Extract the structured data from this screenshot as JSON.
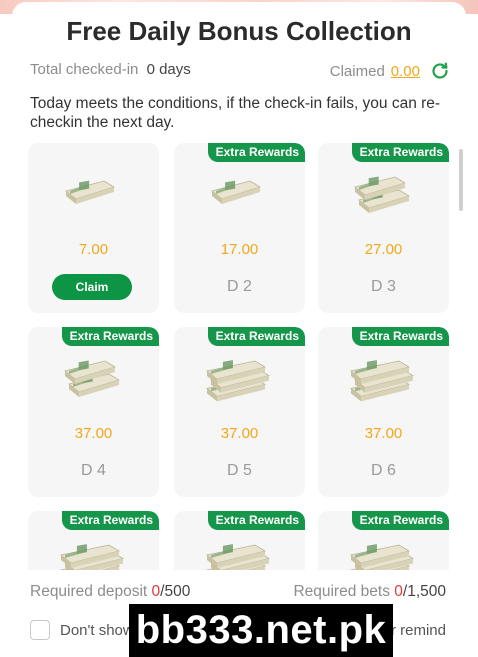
{
  "dialog": {
    "title": "Free Daily Bonus Collection",
    "total_label": "Total checked-in",
    "total_value": "0 days",
    "claimed_label": "Claimed",
    "claimed_value": "0.00",
    "notice": "Today meets the conditions, if the check-in fails, you can re-checkin the next day."
  },
  "cards": [
    {
      "amount": "7.00",
      "day": "",
      "badge": "",
      "button": "Claim",
      "stack": "small"
    },
    {
      "amount": "17.00",
      "day": "D 2",
      "badge": "Extra Rewards",
      "button": "",
      "stack": "small"
    },
    {
      "amount": "27.00",
      "day": "D 3",
      "badge": "Extra Rewards",
      "button": "",
      "stack": "medium"
    },
    {
      "amount": "37.00",
      "day": "D 4",
      "badge": "Extra Rewards",
      "button": "",
      "stack": "medium"
    },
    {
      "amount": "37.00",
      "day": "D 5",
      "badge": "Extra Rewards",
      "button": "",
      "stack": "large"
    },
    {
      "amount": "37.00",
      "day": "D 6",
      "badge": "Extra Rewards",
      "button": "",
      "stack": "large"
    },
    {
      "amount": "",
      "day": "",
      "badge": "Extra Rewards",
      "button": "",
      "stack": "xlarge"
    },
    {
      "amount": "",
      "day": "",
      "badge": "Extra Rewards",
      "button": "",
      "stack": "xlarge"
    },
    {
      "amount": "",
      "day": "",
      "badge": "Extra Rewards",
      "button": "",
      "stack": "xlarge"
    }
  ],
  "requirements": {
    "deposit_label": "Required deposit",
    "deposit_current": "0",
    "deposit_target": "/500",
    "bets_label": "Required bets",
    "bets_current": "0",
    "bets_target": "/1,500"
  },
  "remind": {
    "dont_show": "Don't show",
    "tail": "r remind"
  },
  "watermark": "bb333.net.pk",
  "colors": {
    "accent_green": "#16964a",
    "amount_orange": "#f0a81a",
    "counter_red": "#e53935"
  },
  "icons": {
    "refresh": "refresh-icon",
    "money": "cash-stack-icon"
  }
}
